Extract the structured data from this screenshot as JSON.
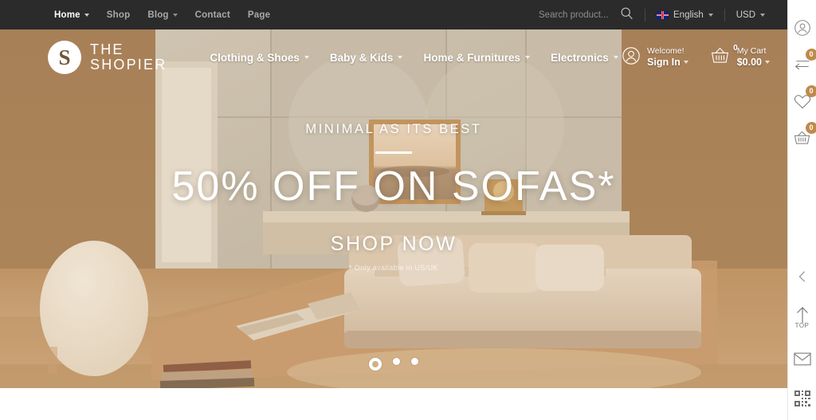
{
  "topbar": {
    "nav": [
      {
        "label": "Home",
        "has_caret": true,
        "active": true
      },
      {
        "label": "Shop",
        "has_caret": false,
        "active": false
      },
      {
        "label": "Blog",
        "has_caret": true,
        "active": false
      },
      {
        "label": "Contact",
        "has_caret": false,
        "active": false
      },
      {
        "label": "Page",
        "has_caret": false,
        "active": false
      }
    ],
    "search": {
      "placeholder": "Search product...",
      "value": "",
      "icon": "search-icon"
    },
    "language": {
      "label": "English",
      "flag": "uk-flag"
    },
    "currency": {
      "label": "USD"
    }
  },
  "header": {
    "logo": {
      "mark": "S",
      "line1": "THE",
      "line2": "SHOPIER"
    },
    "nav": [
      {
        "label": "Clothing & Shoes"
      },
      {
        "label": "Baby & Kids"
      },
      {
        "label": "Home & Furnitures"
      },
      {
        "label": "Electronics"
      }
    ],
    "account": {
      "greeting": "Welcome!",
      "action": "Sign In",
      "icon": "user-icon"
    },
    "cart": {
      "title": "My Cart",
      "total": "$0.00",
      "count": "0",
      "icon": "basket-icon"
    }
  },
  "hero": {
    "tagline": "MINIMAL AS ITS BEST",
    "title": "50% OFF ON SOFAS*",
    "cta": "SHOP NOW",
    "note": "* Only available in US/UK",
    "slides": [
      {
        "active": true
      },
      {
        "active": false
      },
      {
        "active": false
      }
    ]
  },
  "rail": {
    "top": [
      {
        "name": "account-icon",
        "badge": null
      },
      {
        "name": "compare-icon",
        "badge": "0"
      },
      {
        "name": "wishlist-icon",
        "badge": "0"
      },
      {
        "name": "cart-icon",
        "badge": "0"
      }
    ],
    "bottom": [
      {
        "name": "collapse-icon",
        "label": ""
      },
      {
        "name": "scroll-top-icon",
        "label": "TOP"
      },
      {
        "name": "mail-icon",
        "label": ""
      },
      {
        "name": "qr-code-icon",
        "label": ""
      }
    ]
  },
  "colors": {
    "topbar_bg": "#2b2b2b",
    "badge": "#bf8a4b",
    "hero_warm": "#c9a782",
    "header_brown": "#7a5f3e"
  }
}
